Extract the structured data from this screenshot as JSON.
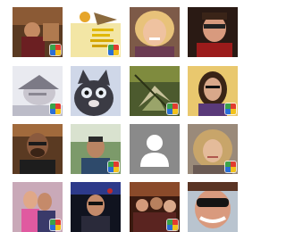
{
  "gallery": {
    "tiles": [
      {
        "name": "friend-photo-1",
        "style": "warm-dark-room",
        "badge": true
      },
      {
        "name": "friend-photo-2",
        "style": "yellow-poster",
        "badge": true
      },
      {
        "name": "friend-photo-3",
        "style": "blonde-smile",
        "badge": false
      },
      {
        "name": "friend-photo-4",
        "style": "dark-glasses-man",
        "badge": false
      },
      {
        "name": "friend-photo-5",
        "style": "pale-hat-face",
        "badge": true
      },
      {
        "name": "friend-photo-6",
        "style": "grey-cat",
        "badge": false
      },
      {
        "name": "friend-photo-7",
        "style": "butterfly-green",
        "badge": true
      },
      {
        "name": "friend-photo-8",
        "style": "brunette-yellow",
        "badge": true
      },
      {
        "name": "friend-photo-9",
        "style": "man-beard-dark",
        "badge": false
      },
      {
        "name": "friend-photo-10",
        "style": "man-outdoor",
        "badge": true
      },
      {
        "name": "friend-photo-11",
        "style": "default-avatar",
        "badge": false
      },
      {
        "name": "friend-photo-12",
        "style": "blonde-woman-2",
        "badge": true
      },
      {
        "name": "friend-photo-13",
        "style": "couple-pink",
        "badge": true
      },
      {
        "name": "friend-photo-14",
        "style": "man-blue-dark",
        "badge": false
      },
      {
        "name": "friend-photo-15",
        "style": "group-night",
        "badge": true
      },
      {
        "name": "friend-photo-16",
        "style": "sunglasses-woman",
        "badge": false
      }
    ],
    "badge_icon": "multicolor-network-icon",
    "colors": {
      "badge_green": "#3aa24a",
      "badge_red": "#e23b2f",
      "badge_blue": "#2a6fd6",
      "badge_yellow": "#f2c21b",
      "avatar_bg": "#8a8a8a"
    }
  }
}
